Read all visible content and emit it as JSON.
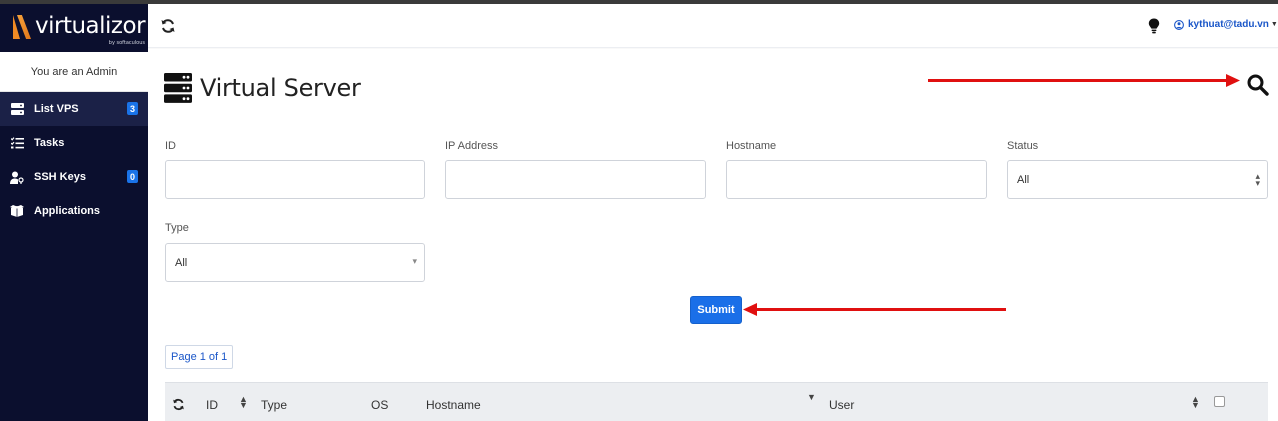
{
  "app": {
    "brand": "virtualizor",
    "brand_sub": "by softaculous"
  },
  "sidebar": {
    "admin_text": "You are an Admin",
    "items": [
      {
        "label": "List VPS",
        "icon": "server-icon",
        "badge": "3",
        "active": true
      },
      {
        "label": "Tasks",
        "icon": "tasks-list-icon",
        "badge": null,
        "active": false
      },
      {
        "label": "SSH Keys",
        "icon": "user-key-icon",
        "badge": "0",
        "active": false
      },
      {
        "label": "Applications",
        "icon": "boxes-icon",
        "badge": null,
        "active": false
      }
    ]
  },
  "header": {
    "refresh_icon": "refresh-icon",
    "bulb_icon": "lightbulb-icon",
    "user_email": "kythuat@tadu.vn"
  },
  "main": {
    "title": "Virtual Server",
    "title_icon": "server-stack-icon",
    "search_icon": "search-icon",
    "filters": {
      "id_label": "ID",
      "id_value": "",
      "ip_label": "IP Address",
      "ip_value": "",
      "hostname_label": "Hostname",
      "hostname_value": "",
      "status_label": "Status",
      "status_value": "All",
      "type_label": "Type",
      "type_value": "All"
    },
    "submit_label": "Submit",
    "pager_text": "Page 1 of 1",
    "table": {
      "columns": [
        "ID",
        "Type",
        "OS",
        "Hostname",
        "User"
      ]
    }
  },
  "colors": {
    "sidebar_bg": "#0b0f2e",
    "accent": "#1a6fe8",
    "annotation_arrow": "#e01010"
  }
}
